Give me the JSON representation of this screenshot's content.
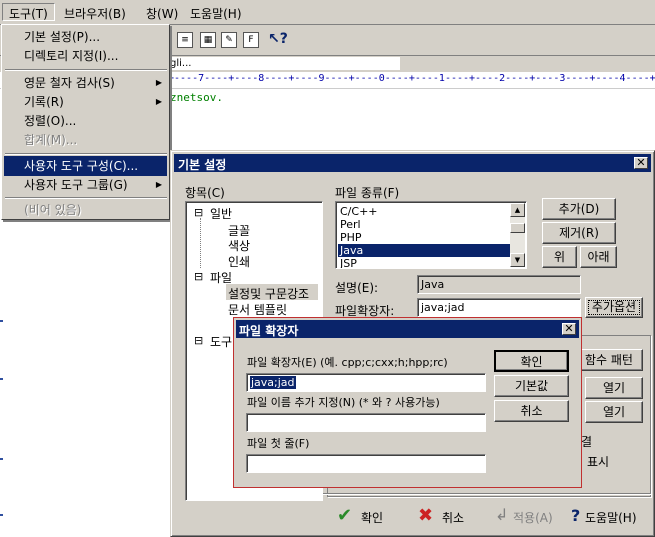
{
  "menubar": {
    "items": [
      {
        "label": "도구(T)"
      },
      {
        "label": "브라우저(B)"
      },
      {
        "label": "창(W)"
      },
      {
        "label": "도움말(H)"
      }
    ]
  },
  "tools_menu": {
    "items": [
      {
        "label": "기본 설정(P)...",
        "disabled": false
      },
      {
        "label": "디렉토리 지정(I)...",
        "disabled": false
      },
      {
        "label": "영문 철자 검사(S)",
        "disabled": false
      },
      {
        "label": "기록(R)",
        "disabled": false
      },
      {
        "label": "정렬(O)...",
        "disabled": false
      },
      {
        "label": "합계(M)...",
        "disabled": true
      },
      {
        "label": "사용자 도구 구성(C)...",
        "disabled": false
      },
      {
        "label": "사용자 도구 그룹(G)",
        "disabled": false
      },
      {
        "label": "(비어 있음)",
        "disabled": true
      }
    ]
  },
  "editor": {
    "path_text": "gli...",
    "ruler": "+----7----+----8----+----9----+----0----+----1----+----2----+----3----+----4----+----5----+----6",
    "line_text": "znetsov."
  },
  "prefs_dialog": {
    "title": "기본 설정",
    "category_label": "항목(C)",
    "tree": [
      {
        "label": "일반",
        "expander": "⊟"
      },
      {
        "label": "글꼴"
      },
      {
        "label": "색상"
      },
      {
        "label": "인쇄"
      },
      {
        "label": "파일",
        "expander": "⊟"
      },
      {
        "label": "설정및 구문강조"
      },
      {
        "label": "문서 템플릿"
      },
      {
        "label": "도구",
        "expander": "⊟"
      }
    ],
    "filetype_label": "파일 종류(F)",
    "filetypes": [
      "C/C++",
      "Perl",
      "PHP",
      "Java",
      "JSP"
    ],
    "selected_filetype": "Java",
    "add_btn": "추가(D)",
    "remove_btn": "제거(R)",
    "up_btn": "위",
    "down_btn": "아래",
    "desc_label": "설명(E):",
    "desc_value": "Java",
    "ext_label": "파일확장자:",
    "ext_value": "java;jad",
    "ext_extra_btn": "추가옵션",
    "pattern_btn": "함수 패턴",
    "open_btn": "열기",
    "partial_text_1": "결",
    "partial_text_2": "표시",
    "ok_btn": "확인",
    "cancel_btn": "취소",
    "apply_btn": "적용(A)",
    "help_btn": "도움말(H)"
  },
  "ext_dialog": {
    "title": "파일 확장자",
    "ext_label": "파일 확장자(E) (예. cpp;c;cxx;h;hpp;rc)",
    "ext_value": "java;jad",
    "name_label": "파일 이름 추가 지정(N) (* 와 ? 사용가능)",
    "name_value": "",
    "firstline_label": "파일 첫 줄(F)",
    "firstline_value": "",
    "ok_btn": "확인",
    "default_btn": "기본값",
    "cancel_btn": "취소"
  }
}
